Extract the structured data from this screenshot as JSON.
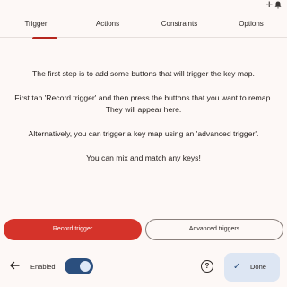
{
  "status_bar": {
    "icons": [
      "plus-icon",
      "bell-icon"
    ]
  },
  "tabs": [
    {
      "label": "Trigger",
      "selected": true
    },
    {
      "label": "Actions"
    },
    {
      "label": "Constraints"
    },
    {
      "label": "Options"
    }
  ],
  "content": {
    "paragraphs": [
      "The first step is to add some buttons that will trigger the key map.",
      "First tap 'Record trigger' and then press the buttons that you want to remap. They will appear here.",
      "Alternatively, you can trigger a key map using an 'advanced trigger'.",
      "You can mix and match any keys!"
    ]
  },
  "buttons": {
    "record_trigger": "Record trigger",
    "advanced_triggers": "Advanced triggers"
  },
  "bottom_bar": {
    "enabled_label": "Enabled",
    "enabled_toggle_on": true,
    "done_label": "Done"
  },
  "colors": {
    "accent_red": "#d5332a",
    "toggle_blue": "#2b4f7e",
    "done_bg": "#dde6f3"
  }
}
